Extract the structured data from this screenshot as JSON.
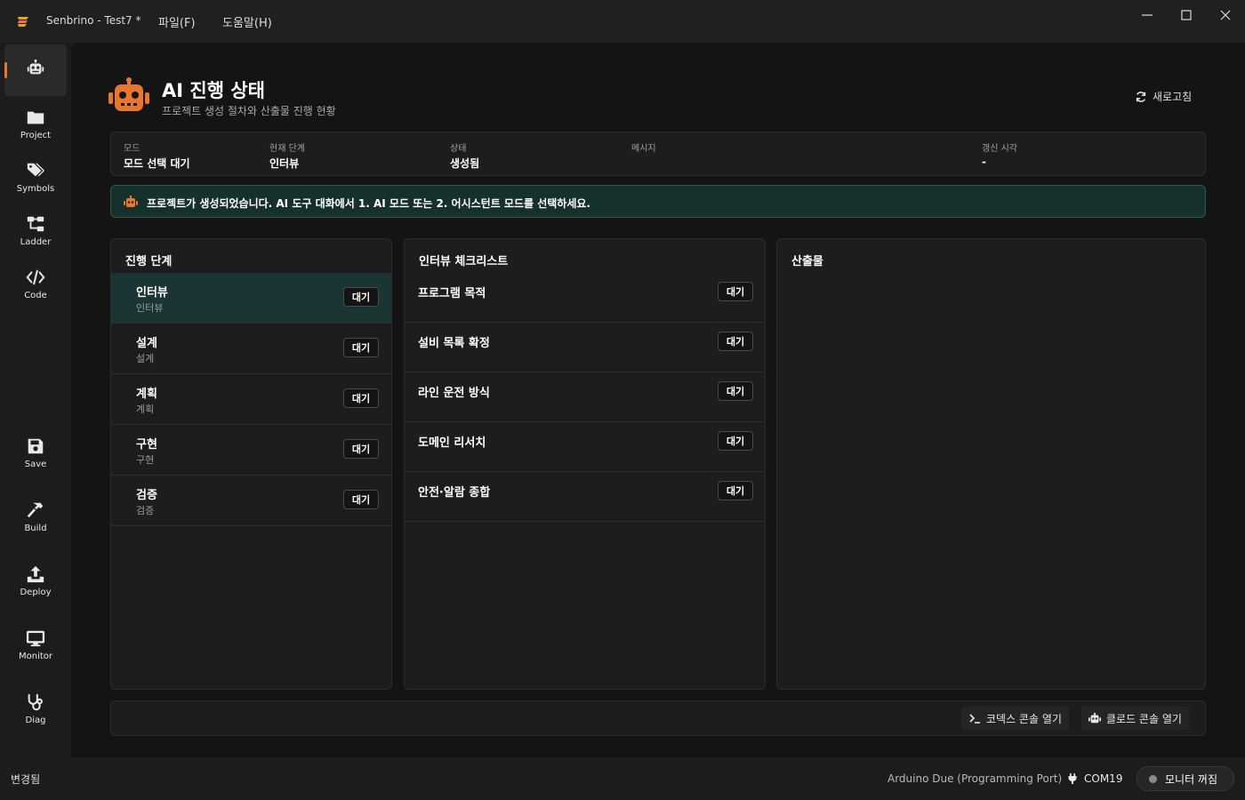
{
  "app": {
    "title": "Senbrino - Test7 *",
    "menu": {
      "file": "파일(F)",
      "help": "도움말(H)"
    },
    "accent_color": "#e8762c"
  },
  "sidebar": {
    "items": [
      {
        "label": "",
        "icon": "robot-icon",
        "active": true
      },
      {
        "label": "Project",
        "icon": "folder-icon"
      },
      {
        "label": "Symbols",
        "icon": "tags-icon"
      },
      {
        "label": "Ladder",
        "icon": "network-icon"
      },
      {
        "label": "Code",
        "icon": "code-icon"
      },
      {
        "label": "Save",
        "icon": "save-icon"
      },
      {
        "label": "Build",
        "icon": "hammer-icon"
      },
      {
        "label": "Deploy",
        "icon": "upload-icon"
      },
      {
        "label": "Monitor",
        "icon": "monitor-icon"
      },
      {
        "label": "Diag",
        "icon": "stethoscope-icon"
      }
    ]
  },
  "header": {
    "title": "AI 진행 상태",
    "subtitle": "프로젝트 생성 절차와 산출물 진행 현황",
    "refresh_label": "새로고침"
  },
  "info": {
    "mode_label": "모드",
    "mode_value": "모드 선택 대기",
    "step_label": "현재 단계",
    "step_value": "인터뷰",
    "status_label": "상태",
    "status_value": "생성됨",
    "message_label": "메시지",
    "message_value": "",
    "updated_label": "갱신 시각",
    "updated_value": "-"
  },
  "banner": {
    "text": "프로젝트가 생성되었습니다. AI 도구 대화에서 1. AI 모드 또는 2. 어시스턴트 모드를 선택하세요."
  },
  "stages": {
    "title": "진행 단계",
    "items": [
      {
        "name": "인터뷰",
        "sub": "인터뷰",
        "badge": "대기",
        "active": true
      },
      {
        "name": "설계",
        "sub": "설계",
        "badge": "대기"
      },
      {
        "name": "계획",
        "sub": "계획",
        "badge": "대기"
      },
      {
        "name": "구현",
        "sub": "구현",
        "badge": "대기"
      },
      {
        "name": "검증",
        "sub": "검증",
        "badge": "대기"
      }
    ]
  },
  "checklist": {
    "title": "인터뷰 체크리스트",
    "items": [
      {
        "name": "프로그램 목적",
        "badge": "대기"
      },
      {
        "name": "설비 목록 확정",
        "badge": "대기"
      },
      {
        "name": "라인 운전 방식",
        "badge": "대기"
      },
      {
        "name": "도메인 리서치",
        "badge": "대기"
      },
      {
        "name": "안전·알람 종합",
        "badge": "대기"
      }
    ]
  },
  "outputs": {
    "title": "산출물"
  },
  "bottom": {
    "codex_label": "코덱스 콘솔 열기",
    "claude_label": "클로드 콘솔 열기"
  },
  "status": {
    "left": "변경됨",
    "board": "Arduino Due (Programming Port)",
    "port": "COM19",
    "monitor": "모니터 꺼짐"
  }
}
